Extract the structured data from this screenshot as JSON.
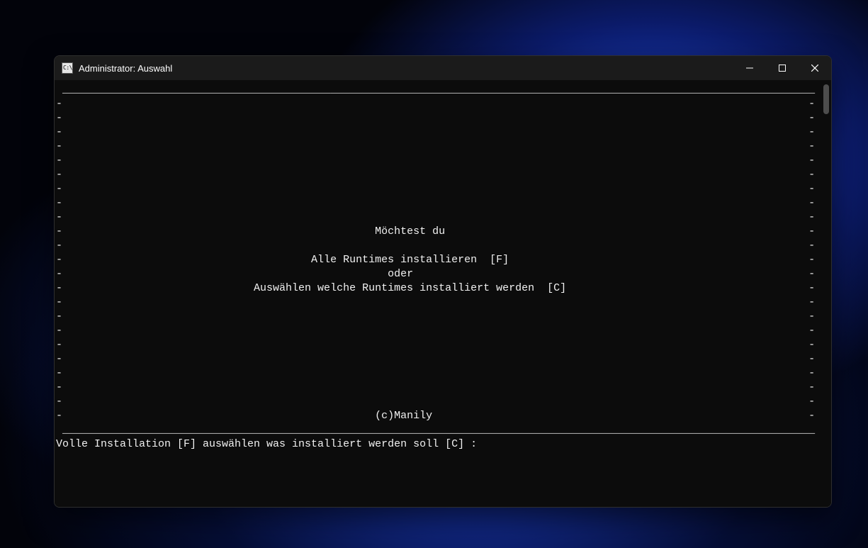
{
  "window": {
    "title": "Administrator:  Auswahl",
    "icon_glyph": "C:\\"
  },
  "terminal": {
    "box_top": " ______________________________________________________________________________________________________________________",
    "box_blank": "-                                                                                                                     -",
    "line_q": "-                                                 Möchtest du                                                         -",
    "line_all": "-                                       Alle Runtimes installieren  [F]                                               -",
    "line_or": "-                                                   oder                                                              -",
    "line_sel": "-                              Auswählen welche Runtimes installiert werden  [C]                                      -",
    "line_copy": "-                                                 (c)Manily                                                           -",
    "box_bot": " ______________________________________________________________________________________________________________________",
    "prompt": "Volle Installation [F] auswählen was installiert werden soll [C] : "
  }
}
